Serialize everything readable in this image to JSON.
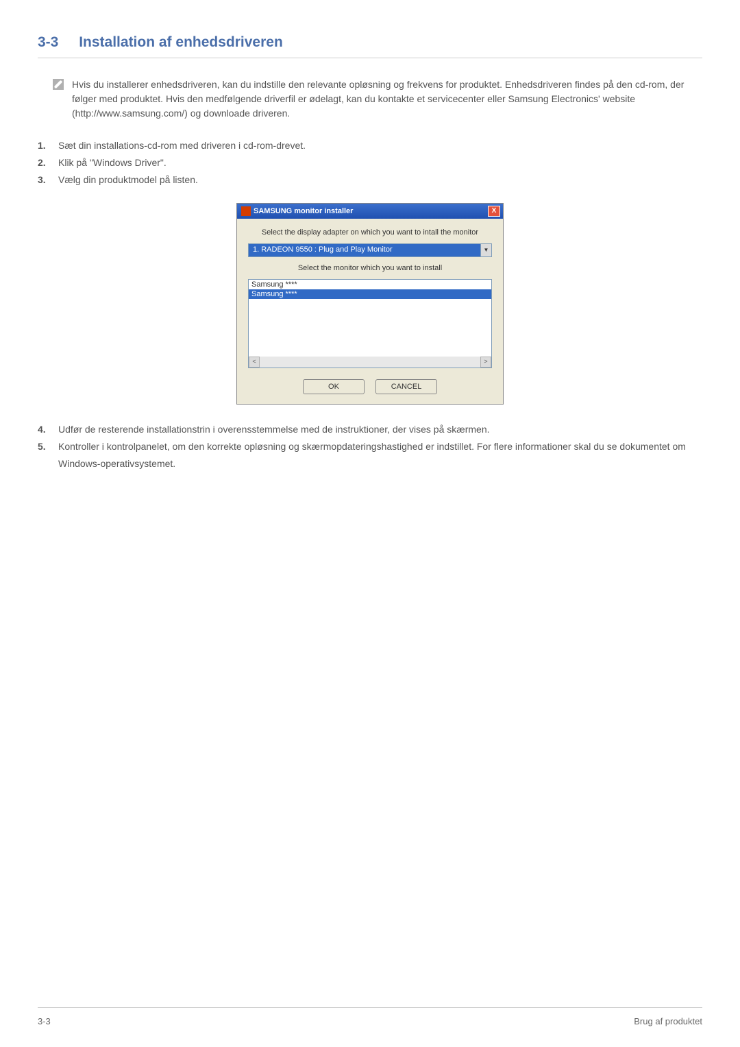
{
  "heading": {
    "number": "3-3",
    "title": "Installation af enhedsdriveren"
  },
  "info_text": "Hvis du installerer enhedsdriveren, kan du indstille den relevante opløsning og frekvens for produktet. Enhedsdriveren findes på den cd-rom, der følger med produktet. Hvis den medfølgende driverfil er ødelagt, kan du kontakte et servicecenter eller Samsung Electronics' website (http://www.samsung.com/) og downloade driveren.",
  "steps_a": [
    "Sæt din installations-cd-rom med driveren i cd-rom-drevet.",
    "Klik på \"Windows Driver\".",
    "Vælg din produktmodel på listen."
  ],
  "steps_b": [
    "Udfør de resterende installationstrin i overensstemmelse med de instruktioner, der vises på skærmen.",
    "Kontroller i kontrolpanelet, om den korrekte opløsning og skærmopdateringshastighed er indstillet. For flere informationer skal du se dokumentet om Windows-operativsystemet."
  ],
  "dialog": {
    "title": "SAMSUNG monitor installer",
    "label1": "Select the display adapter on which you want to intall the monitor",
    "adapter": "1. RADEON 9550 : Plug and Play Monitor",
    "label2": "Select the monitor which you want to install",
    "monitors": [
      "Samsung ****",
      "Samsung ****"
    ],
    "close": "X",
    "ok": "OK",
    "cancel": "CANCEL",
    "scroll_left": "<",
    "scroll_right": ">"
  },
  "footer": {
    "left": "3-3",
    "right": "Brug af produktet"
  }
}
